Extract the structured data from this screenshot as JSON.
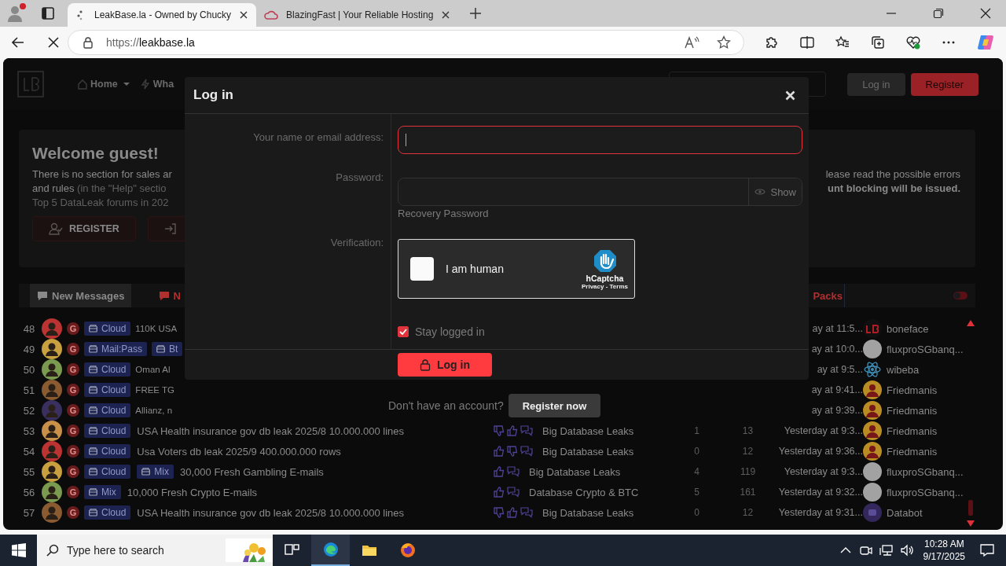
{
  "browser": {
    "tabs": [
      {
        "title": "LeakBase.la - Owned by Chucky",
        "selected": true,
        "loading": true
      },
      {
        "title": "BlazingFast | Your Reliable Hosting",
        "selected": false,
        "loading": false
      }
    ],
    "url_scheme": "https://",
    "url_host": "leakbase.la"
  },
  "site": {
    "nav": [
      {
        "label": "Home",
        "dropdown": true
      },
      {
        "label": "Wha",
        "dropdown": false
      }
    ],
    "auth_buttons": [
      {
        "label": "Log in",
        "kind": "secondary"
      },
      {
        "label": "Register",
        "kind": "primary"
      }
    ],
    "welcome": {
      "title": "Welcome guest!",
      "lines": [
        {
          "text": "There is no section for sales ar",
          "side_text": "lease read the possible errors"
        },
        {
          "text": "and rules",
          "note": "(in the \"Help\" sectio",
          "warning": "unt blocking will be issued."
        },
        {
          "note": "Top 5 DataLeak forums in 202"
        }
      ],
      "buttons": [
        {
          "kind": "register",
          "label": "REGISTER"
        },
        {
          "kind": "login"
        }
      ]
    },
    "tabs": [
      {
        "label": "New Messages",
        "selected": true
      },
      {
        "label": "N",
        "selected": false
      },
      {
        "label": "Packs",
        "selected": false
      }
    ],
    "toggle": {
      "on": false
    },
    "rows": [
      {
        "num": "48",
        "group": "G",
        "tags": [
          "Cloud"
        ],
        "title": "110K USA",
        "time": "ay at 11:5...",
        "user": {
          "name": "boneface",
          "kind": "mark"
        }
      },
      {
        "num": "49",
        "group": "G",
        "tags": [
          "Mail:Pass",
          "Bt"
        ],
        "time": "ay at 10:0...",
        "user": {
          "name": "fluxproSGbanq...",
          "kind": "blank"
        }
      },
      {
        "num": "50",
        "group": "G",
        "tags": [
          "Cloud"
        ],
        "title": "Oman Al",
        "time": "ay at 9:5...",
        "user": {
          "name": "wibeba",
          "kind": "atom"
        }
      },
      {
        "num": "51",
        "group": "G",
        "tags": [
          "Cloud"
        ],
        "title": "FREE TG",
        "time": "ay at 9:41...",
        "user": {
          "name": "Friedmanis",
          "kind": "figure"
        }
      },
      {
        "num": "52",
        "group": "G",
        "tags": [
          "Cloud"
        ],
        "title": "Allianz, n",
        "time": "ay at 9:39...",
        "user": {
          "name": "Friedmanis",
          "kind": "figure"
        }
      },
      {
        "num": "53",
        "group": "G",
        "tags": [
          "Cloud"
        ],
        "title": "USA Health insurance gov db leak 2025/8 10.000.000 lines",
        "reactions": [
          {
            "kind": "dislike"
          },
          {
            "kind": "like"
          }
        ],
        "forum": "Big Database Leaks",
        "replies": "1",
        "views": "13",
        "time": "Yesterday at 9:3...",
        "user": {
          "name": "Friedmanis",
          "kind": "figure"
        }
      },
      {
        "num": "54",
        "group": "G",
        "tags": [
          "Cloud"
        ],
        "title": "Usa Voters db leak 2025/9 400.000.000 rows",
        "reactions": [
          {
            "kind": "like"
          },
          {
            "kind": "dislike"
          }
        ],
        "forum": "Big Database Leaks",
        "replies": "0",
        "views": "12",
        "time": "Yesterday at 9:36...",
        "user": {
          "name": "Friedmanis",
          "kind": "figure"
        }
      },
      {
        "num": "55",
        "group": "G",
        "tags": [
          "Cloud",
          "Mix"
        ],
        "title": "30,000 Fresh Gambling E-mails",
        "reactions": [
          {
            "kind": "like"
          }
        ],
        "forum": "Big Database Leaks",
        "replies": "4",
        "views": "119",
        "time": "Yesterday at 9:3...",
        "user": {
          "name": "fluxproSGbanq...",
          "kind": "blank"
        }
      },
      {
        "num": "56",
        "group": "G",
        "tags": [
          "Mix"
        ],
        "title": "10,000 Fresh Crypto E-mails",
        "reactions": [
          {
            "kind": "like"
          }
        ],
        "forum": "Database Crypto & BTC",
        "replies": "5",
        "views": "161",
        "time": "Yesterday at 9:32...",
        "user": {
          "name": "fluxproSGbanq...",
          "kind": "blank"
        }
      },
      {
        "num": "57",
        "group": "G",
        "tags": [
          "Cloud"
        ],
        "title": "USA Health insurance gov db leak 2025/8 10.000.000 lines",
        "reactions": [
          {
            "kind": "dislike"
          },
          {
            "kind": "like"
          }
        ],
        "forum": "Big Database Leaks",
        "replies": "0",
        "views": "12",
        "time": "Yesterday at 9:31...",
        "user": {
          "name": "Databot",
          "kind": "bot"
        }
      }
    ]
  },
  "modal": {
    "title": "Log in",
    "fields": [
      {
        "kind": "text",
        "label": "Your name or email address:",
        "focused": true
      },
      {
        "kind": "password",
        "label": "Password:",
        "toggle": "Show",
        "link": "Recovery Password"
      },
      {
        "kind": "captcha",
        "label": "Verification:",
        "text": "I am human",
        "brand": "hCaptcha",
        "links": "Privacy - Terms",
        "checked": false
      }
    ],
    "remember": {
      "label": "Stay logged in",
      "checked": true
    },
    "submit": "Log in",
    "signup": {
      "prompt": "Don't have an account?",
      "button": "Register now"
    }
  },
  "taskbar": {
    "search_placeholder": "Type here to search",
    "time": "10:28 AM",
    "date": "9/17/2025"
  }
}
